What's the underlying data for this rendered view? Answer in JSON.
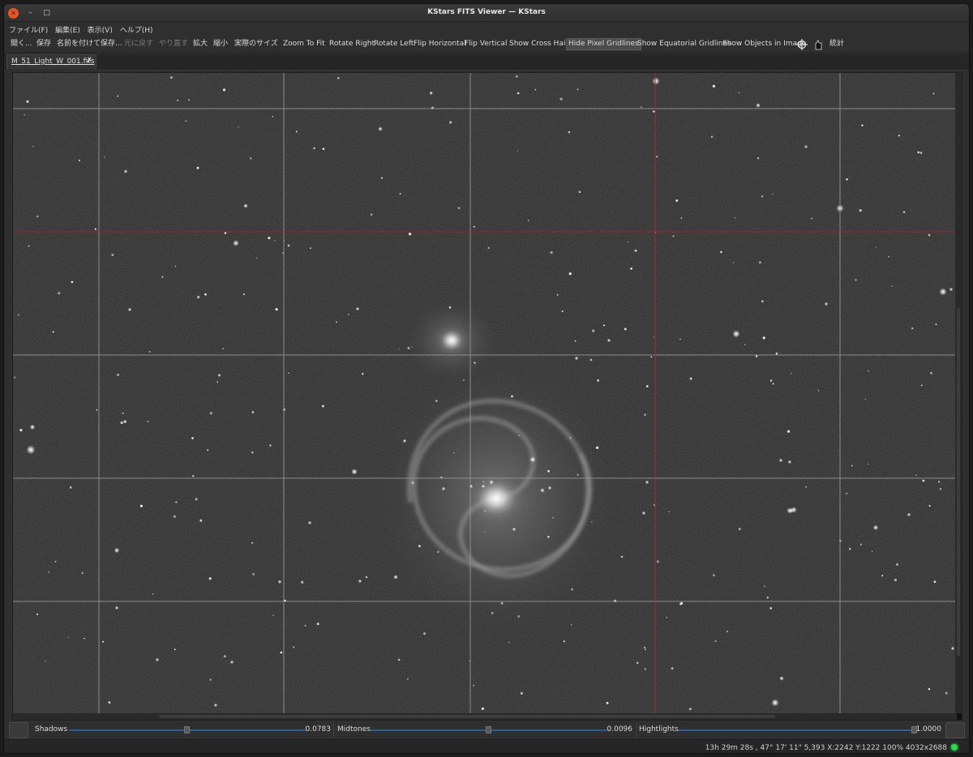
{
  "window": {
    "title": "KStars FITS Viewer — KStars",
    "close_glyph": "✕",
    "min_glyph": "–",
    "max_glyph": "□"
  },
  "menu": [
    "ファイル(F)",
    "編集(E)",
    "表示(V)",
    "ヘルプ(H)"
  ],
  "toolbar": {
    "open": "開く...",
    "save": "保存",
    "save_as": "名前を付けて保存...",
    "undo": "元に戻す",
    "redo": "やり直す",
    "zoom_in": "拡大",
    "zoom_out": "縮小",
    "actual_size": "実際のサイズ",
    "zoom_to_fit": "Zoom To Fit",
    "rotate_right": "Rotate Right",
    "rotate_left": "Rotate Left",
    "flip_horizontal": "Flip Horizontal",
    "flip_vertical": "Flip Vertical",
    "show_cross_hairs": "Show Cross Hairs",
    "hide_pixel_gridlines": "Hide Pixel Gridlines",
    "show_equatorial_gridlines": "Show Equatorial Gridlines",
    "show_objects_in_image": "Show Objects in Image",
    "statistics": "統計",
    "icons": {
      "target": "crosshair-target-icon",
      "mark": "star-mark-icon"
    }
  },
  "tab": {
    "label": "M_51_Light_W_001.fits",
    "close_glyph": "✗"
  },
  "stretch": {
    "shadows": {
      "label": "Shadows",
      "value": "0.0783",
      "fraction": 0.5
    },
    "midtones": {
      "label": "Midtones",
      "value": "0.0096",
      "fraction": 0.5
    },
    "highlights": {
      "label": "Hightlights",
      "value": "1.0000",
      "fraction": 1.0
    }
  },
  "status": {
    "text": "13h 29m 28s ,  47° 17' 11\"  5,393  X:2242 Y:1222  100%  4032x2688",
    "led_color": "#22dd44"
  },
  "colors": {
    "grid": "#9a9a9a",
    "crosshair": "#b02020",
    "slider": "#2b5e93"
  }
}
